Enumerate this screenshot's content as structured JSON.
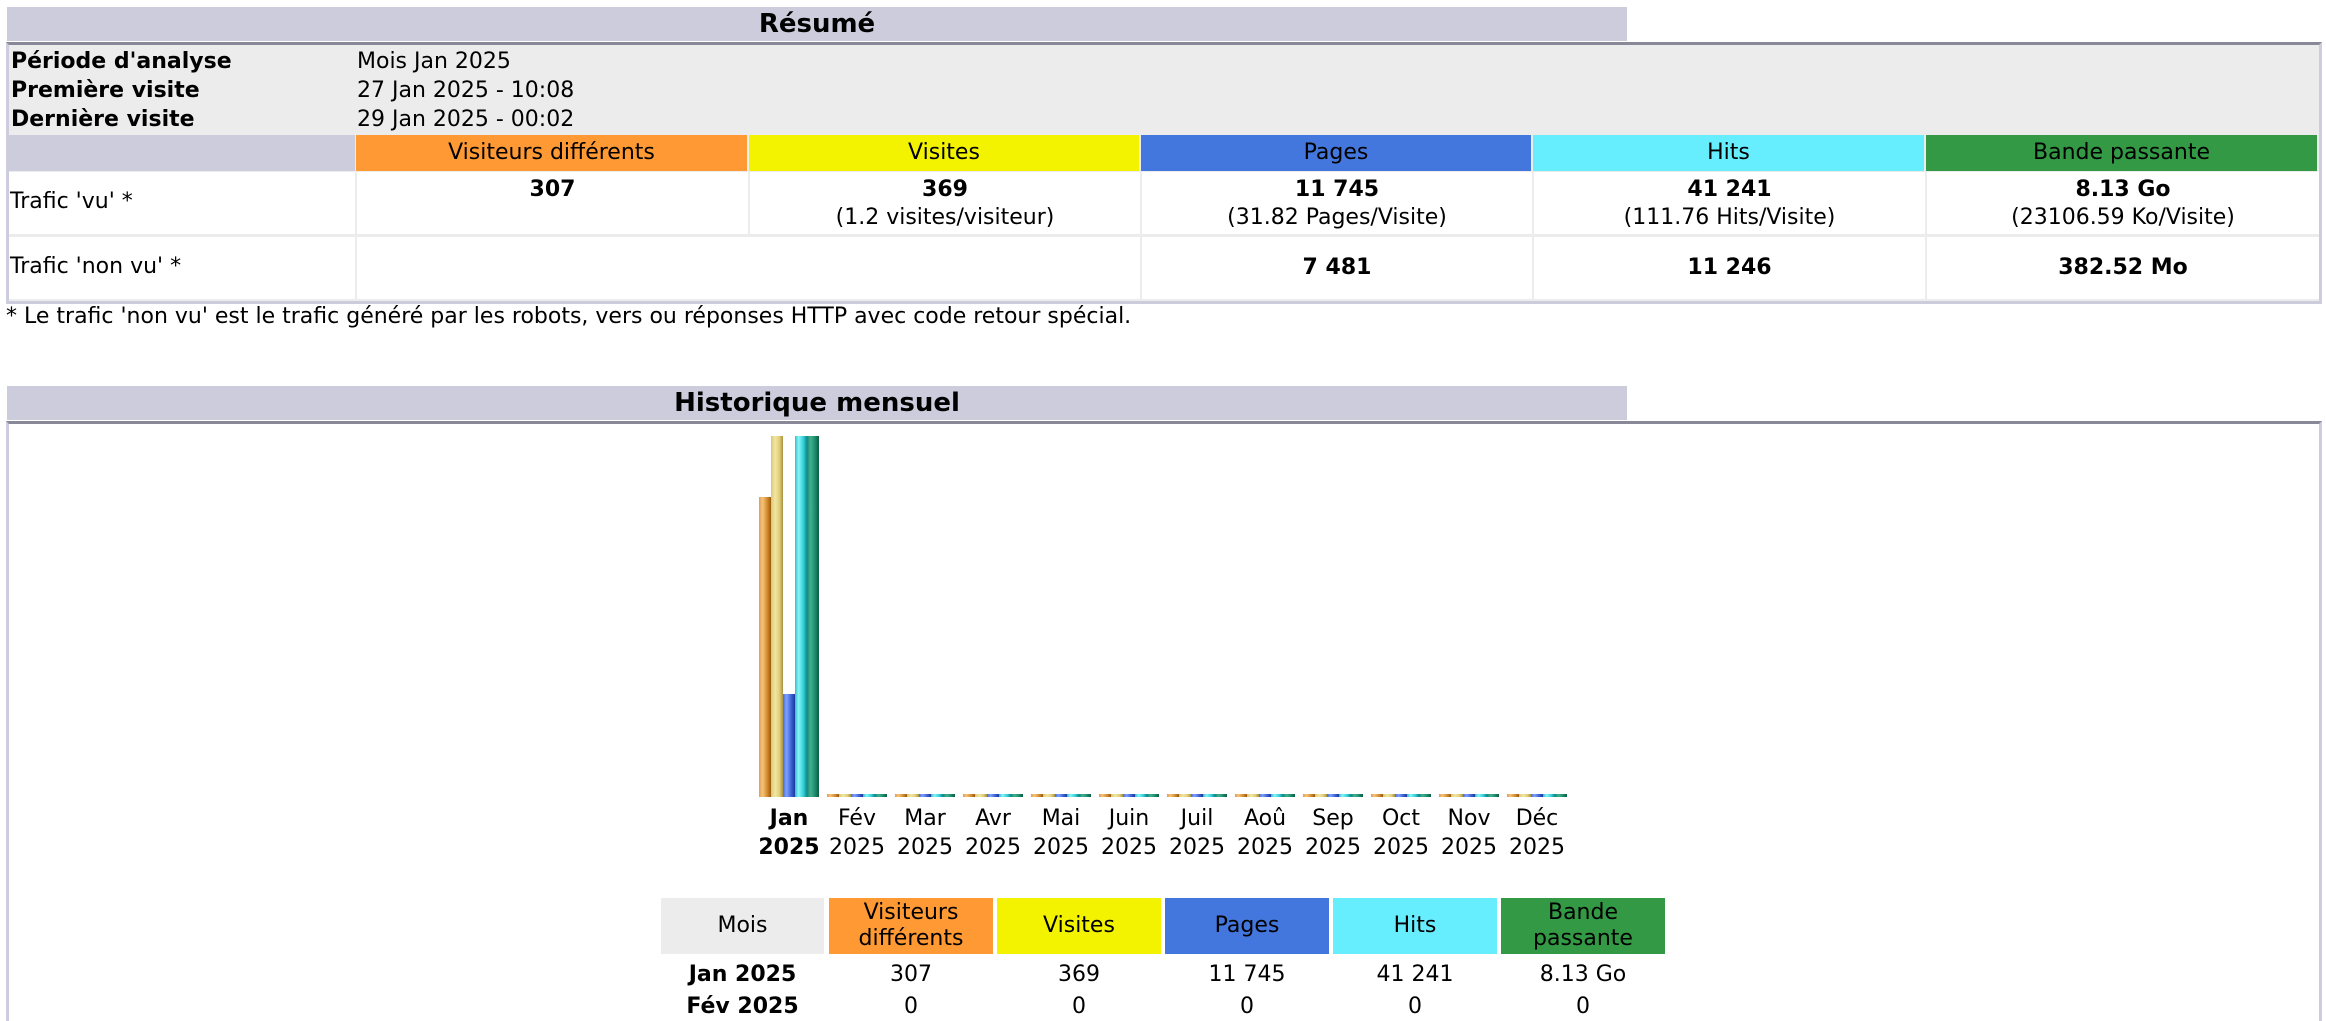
{
  "colors": {
    "title_bg": "#CCCCDD",
    "info_bg": "#ECECEC",
    "visitors": "#FF9933",
    "visits": "#F3F300",
    "pages": "#4477DD",
    "hits": "#66EEFF",
    "bandwidth": "#339944"
  },
  "summary": {
    "title": "Résumé",
    "info": [
      {
        "label": "Période d'analyse",
        "value": "Mois Jan 2025"
      },
      {
        "label": "Première visite",
        "value": "27 Jan 2025 - 10:08"
      },
      {
        "label": "Dernière visite",
        "value": "29 Jan 2025 - 00:02"
      }
    ],
    "columns": [
      "Visiteurs différents",
      "Visites",
      "Pages",
      "Hits",
      "Bande passante"
    ],
    "rows": [
      {
        "label": "Trafic 'vu' *",
        "cells": [
          {
            "value": "307",
            "sub": ""
          },
          {
            "value": "369",
            "sub": "(1.2 visites/visiteur)"
          },
          {
            "value": "11 745",
            "sub": "(31.82 Pages/Visite)"
          },
          {
            "value": "41 241",
            "sub": "(111.76 Hits/Visite)"
          },
          {
            "value": "8.13 Go",
            "sub": "(23106.59 Ko/Visite)"
          }
        ]
      },
      {
        "label": "Trafic 'non vu' *",
        "cells": [
          {
            "value": "",
            "sub": ""
          },
          {
            "value": "",
            "sub": ""
          },
          {
            "value": "7 481",
            "sub": ""
          },
          {
            "value": "11 246",
            "sub": ""
          },
          {
            "value": "382.52 Mo",
            "sub": ""
          }
        ]
      }
    ],
    "footnote": "* Le trafic 'non vu' est le trafic généré par les robots, vers ou réponses HTTP avec code retour spécial."
  },
  "history": {
    "title": "Historique mensuel",
    "table": {
      "headers": [
        "Mois",
        "Visiteurs différents",
        "Visites",
        "Pages",
        "Hits",
        "Bande passante"
      ],
      "rows": [
        [
          "Jan 2025",
          "307",
          "369",
          "11 745",
          "41 241",
          "8.13 Go"
        ],
        [
          "Fév 2025",
          "0",
          "0",
          "0",
          "0",
          "0"
        ]
      ]
    }
  },
  "chart_data": {
    "type": "bar",
    "title": "Historique mensuel",
    "categories": [
      "Jan 2025",
      "Fév 2025",
      "Mar 2025",
      "Avr 2025",
      "Mai 2025",
      "Juin 2025",
      "Juil 2025",
      "Aoû 2025",
      "Sep 2025",
      "Oct 2025",
      "Nov 2025",
      "Déc 2025"
    ],
    "category_labels": [
      [
        "Jan",
        "2025"
      ],
      [
        "Fév",
        "2025"
      ],
      [
        "Mar",
        "2025"
      ],
      [
        "Avr",
        "2025"
      ],
      [
        "Mai",
        "2025"
      ],
      [
        "Juin",
        "2025"
      ],
      [
        "Juil",
        "2025"
      ],
      [
        "Aoû",
        "2025"
      ],
      [
        "Sep",
        "2025"
      ],
      [
        "Oct",
        "2025"
      ],
      [
        "Nov",
        "2025"
      ],
      [
        "Déc",
        "2025"
      ]
    ],
    "current_index": 0,
    "series": [
      {
        "name": "Visiteurs différents",
        "key": "vu",
        "scale_group": "visits",
        "values": [
          307,
          0,
          0,
          0,
          0,
          0,
          0,
          0,
          0,
          0,
          0,
          0
        ]
      },
      {
        "name": "Visites",
        "key": "vi",
        "scale_group": "visits",
        "values": [
          369,
          0,
          0,
          0,
          0,
          0,
          0,
          0,
          0,
          0,
          0,
          0
        ]
      },
      {
        "name": "Pages",
        "key": "pa",
        "scale_group": "hits",
        "values": [
          11745,
          0,
          0,
          0,
          0,
          0,
          0,
          0,
          0,
          0,
          0,
          0
        ]
      },
      {
        "name": "Hits",
        "key": "hi",
        "scale_group": "hits",
        "values": [
          41241,
          0,
          0,
          0,
          0,
          0,
          0,
          0,
          0,
          0,
          0,
          0
        ]
      },
      {
        "name": "Bande passante (Go)",
        "key": "bw",
        "scale_group": "bandwidth",
        "values": [
          8.13,
          0,
          0,
          0,
          0,
          0,
          0,
          0,
          0,
          0,
          0,
          0
        ]
      }
    ],
    "xlabel": "",
    "ylabel": "",
    "grid": false,
    "legend": "none"
  }
}
